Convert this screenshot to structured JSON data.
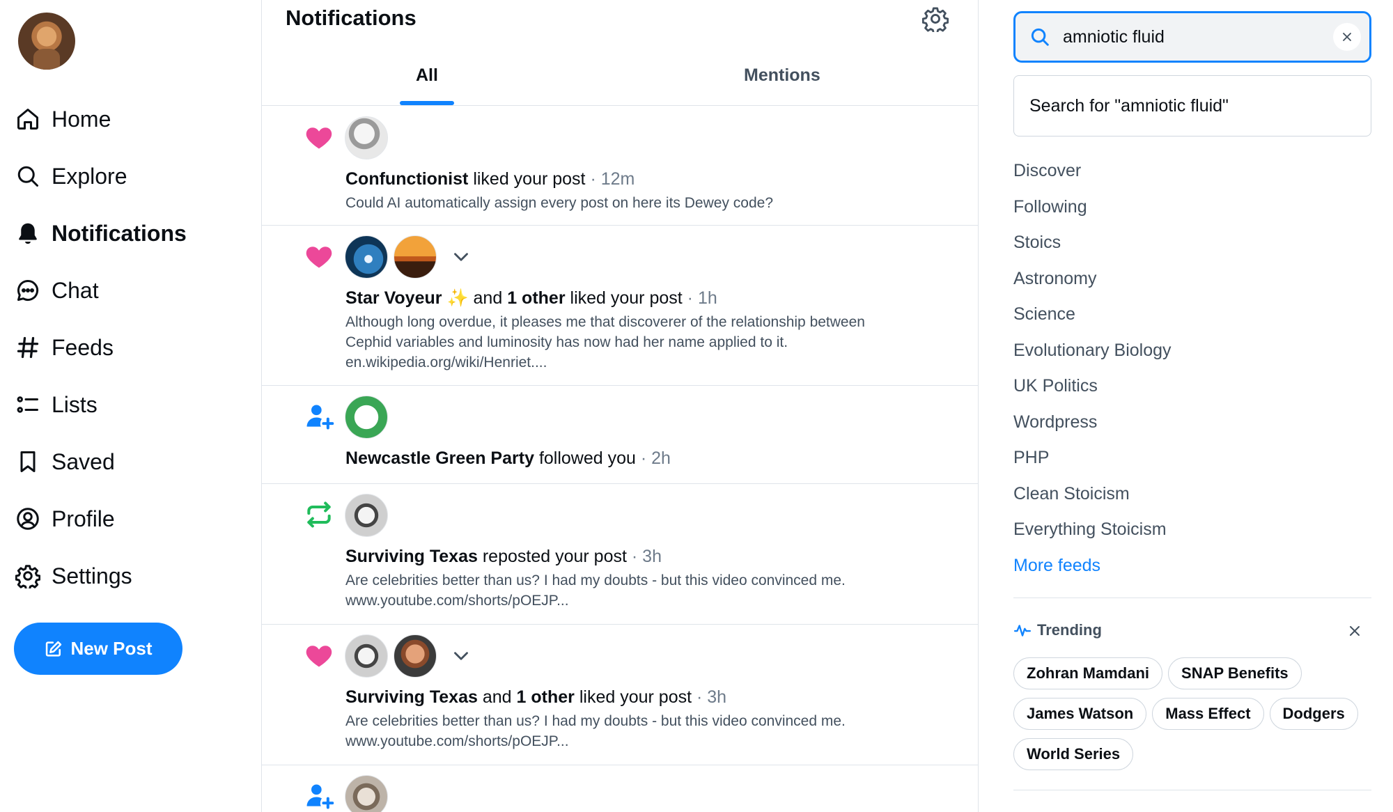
{
  "sidebar": {
    "items": [
      {
        "label": "Home",
        "icon": "home-icon"
      },
      {
        "label": "Explore",
        "icon": "search-icon"
      },
      {
        "label": "Notifications",
        "icon": "bell-icon"
      },
      {
        "label": "Chat",
        "icon": "chat-icon"
      },
      {
        "label": "Feeds",
        "icon": "hash-icon"
      },
      {
        "label": "Lists",
        "icon": "list-icon"
      },
      {
        "label": "Saved",
        "icon": "bookmark-icon"
      },
      {
        "label": "Profile",
        "icon": "profile-icon"
      },
      {
        "label": "Settings",
        "icon": "gear-icon"
      }
    ],
    "active": "Notifications",
    "new_post_label": "New Post"
  },
  "header": {
    "title": "Notifications",
    "tabs": [
      {
        "label": "All",
        "selected": true
      },
      {
        "label": "Mentions",
        "selected": false
      }
    ]
  },
  "notifications": [
    {
      "type": "like",
      "actor": "Confunctionist",
      "action": "liked your post",
      "time": "12m",
      "body": [
        "Could AI automatically assign every post on here its Dewey code?"
      ]
    },
    {
      "type": "like",
      "actor": "Star Voyeur",
      "actor_emoji": "✨",
      "joiner": "and",
      "others": "1 other",
      "action": "liked your post",
      "time": "1h",
      "body": [
        "Although long overdue, it pleases me that discoverer of the relationship between",
        "Cephid variables and luminosity has now had her name applied to it.",
        "en.wikipedia.org/wiki/Henriet...."
      ]
    },
    {
      "type": "follow",
      "actor": "Newcastle Green Party",
      "action": "followed you",
      "time": "2h",
      "body": []
    },
    {
      "type": "repost",
      "actor": "Surviving Texas",
      "action": "reposted your post",
      "time": "3h",
      "body": [
        "Are celebrities better than us? I had my doubts - but this video convinced me.",
        "www.youtube.com/shorts/pOEJP..."
      ]
    },
    {
      "type": "like",
      "actor": "Surviving Texas",
      "joiner": "and",
      "others": "1 other",
      "action": "liked your post",
      "time": "3h",
      "body": [
        "Are celebrities better than us? I had my doubts - but this video convinced me.",
        "www.youtube.com/shorts/pOEJP..."
      ]
    },
    {
      "type": "follow",
      "body": []
    }
  ],
  "search": {
    "value": "amniotic fluid",
    "suggestion": "Search for \"amniotic fluid\""
  },
  "feeds": [
    "Discover",
    "Following",
    "Stoics",
    "Astronomy",
    "Science",
    "Evolutionary Biology",
    "UK Politics",
    "Wordpress",
    "PHP",
    "Clean Stoicism",
    "Everything Stoicism"
  ],
  "more_feeds_label": "More feeds",
  "trending": {
    "title": "Trending",
    "rows": [
      [
        "Zohran Mamdani",
        "SNAP Benefits"
      ],
      [
        "James Watson",
        "Mass Effect",
        "Dodgers"
      ],
      [
        "World Series"
      ]
    ]
  },
  "colors": {
    "accent": "#1083fe",
    "like": "#ec4899",
    "follow": "#1083fe",
    "repost": "#20bc5b",
    "muted_text": "#43505e",
    "meta_text": "#6e7b8a"
  }
}
